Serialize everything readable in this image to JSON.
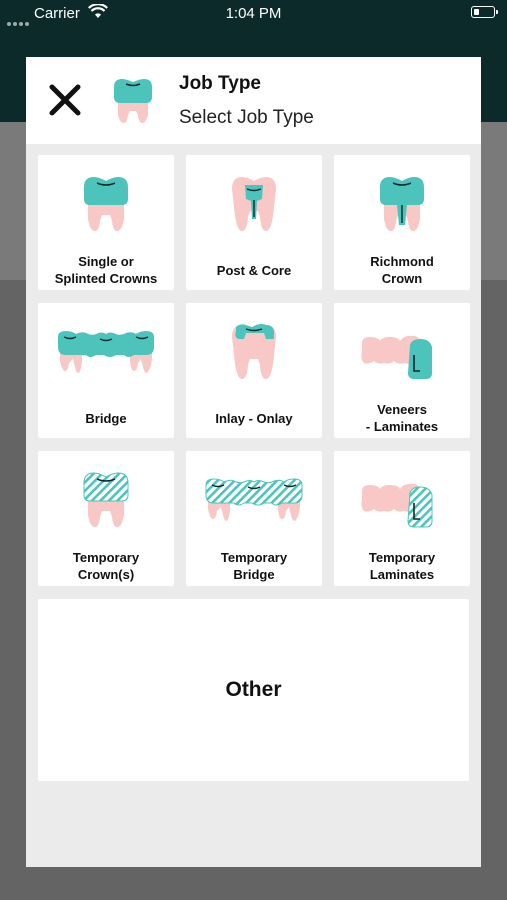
{
  "status_bar": {
    "carrier": "Carrier",
    "time": "1:04 PM"
  },
  "modal": {
    "title": "Job Type",
    "subtitle": "Select Job Type"
  },
  "job_types": [
    {
      "label": "Single or\nSplinted Crowns",
      "icon": "crown-icon"
    },
    {
      "label": "Post & Core",
      "icon": "post-core-icon"
    },
    {
      "label": "Richmond\nCrown",
      "icon": "richmond-crown-icon"
    },
    {
      "label": "Bridge",
      "icon": "bridge-icon"
    },
    {
      "label": "Inlay - Onlay",
      "icon": "inlay-onlay-icon"
    },
    {
      "label": "Veneers\n- Laminates",
      "icon": "veneers-icon"
    },
    {
      "label": "Temporary\nCrown(s)",
      "icon": "temporary-crown-icon"
    },
    {
      "label": "Temporary\nBridge",
      "icon": "temporary-bridge-icon"
    },
    {
      "label": "Temporary\nLaminates",
      "icon": "temporary-laminates-icon"
    }
  ],
  "other": {
    "label": "Other"
  },
  "colors": {
    "teal": "#4cc4bc",
    "pink": "#f8c8c6",
    "dark": "#0c2a2a"
  }
}
